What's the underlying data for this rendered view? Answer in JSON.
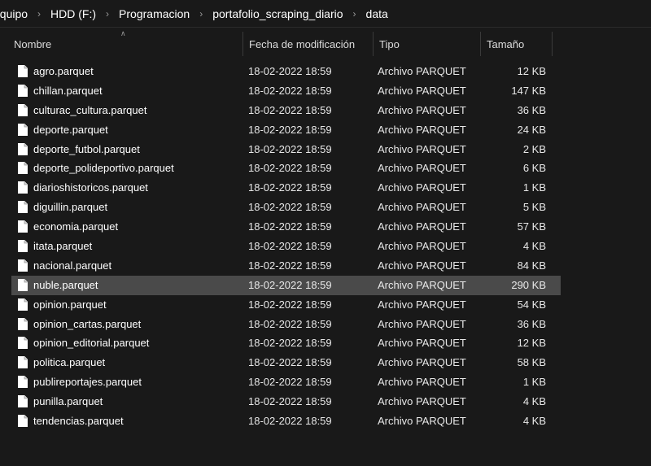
{
  "breadcrumb": [
    "equipo",
    "HDD (F:)",
    "Programacion",
    "portafolio_scraping_diario",
    "data"
  ],
  "columns": {
    "name": "Nombre",
    "date": "Fecha de modificación",
    "type": "Tipo",
    "size": "Tamaño"
  },
  "colors": {
    "background": "#191919",
    "selected_row": "#4a4a4a",
    "text": "#ffffff"
  },
  "selected_index": 11,
  "files": [
    {
      "name": "agro.parquet",
      "date": "18-02-2022 18:59",
      "type": "Archivo PARQUET",
      "size": "12 KB"
    },
    {
      "name": "chillan.parquet",
      "date": "18-02-2022 18:59",
      "type": "Archivo PARQUET",
      "size": "147 KB"
    },
    {
      "name": "culturac_cultura.parquet",
      "date": "18-02-2022 18:59",
      "type": "Archivo PARQUET",
      "size": "36 KB"
    },
    {
      "name": "deporte.parquet",
      "date": "18-02-2022 18:59",
      "type": "Archivo PARQUET",
      "size": "24 KB"
    },
    {
      "name": "deporte_futbol.parquet",
      "date": "18-02-2022 18:59",
      "type": "Archivo PARQUET",
      "size": "2 KB"
    },
    {
      "name": "deporte_polideportivo.parquet",
      "date": "18-02-2022 18:59",
      "type": "Archivo PARQUET",
      "size": "6 KB"
    },
    {
      "name": "diarioshistoricos.parquet",
      "date": "18-02-2022 18:59",
      "type": "Archivo PARQUET",
      "size": "1 KB"
    },
    {
      "name": "diguillin.parquet",
      "date": "18-02-2022 18:59",
      "type": "Archivo PARQUET",
      "size": "5 KB"
    },
    {
      "name": "economia.parquet",
      "date": "18-02-2022 18:59",
      "type": "Archivo PARQUET",
      "size": "57 KB"
    },
    {
      "name": "itata.parquet",
      "date": "18-02-2022 18:59",
      "type": "Archivo PARQUET",
      "size": "4 KB"
    },
    {
      "name": "nacional.parquet",
      "date": "18-02-2022 18:59",
      "type": "Archivo PARQUET",
      "size": "84 KB"
    },
    {
      "name": "nuble.parquet",
      "date": "18-02-2022 18:59",
      "type": "Archivo PARQUET",
      "size": "290 KB"
    },
    {
      "name": "opinion.parquet",
      "date": "18-02-2022 18:59",
      "type": "Archivo PARQUET",
      "size": "54 KB"
    },
    {
      "name": "opinion_cartas.parquet",
      "date": "18-02-2022 18:59",
      "type": "Archivo PARQUET",
      "size": "36 KB"
    },
    {
      "name": "opinion_editorial.parquet",
      "date": "18-02-2022 18:59",
      "type": "Archivo PARQUET",
      "size": "12 KB"
    },
    {
      "name": "politica.parquet",
      "date": "18-02-2022 18:59",
      "type": "Archivo PARQUET",
      "size": "58 KB"
    },
    {
      "name": "publireportajes.parquet",
      "date": "18-02-2022 18:59",
      "type": "Archivo PARQUET",
      "size": "1 KB"
    },
    {
      "name": "punilla.parquet",
      "date": "18-02-2022 18:59",
      "type": "Archivo PARQUET",
      "size": "4 KB"
    },
    {
      "name": "tendencias.parquet",
      "date": "18-02-2022 18:59",
      "type": "Archivo PARQUET",
      "size": "4 KB"
    }
  ]
}
